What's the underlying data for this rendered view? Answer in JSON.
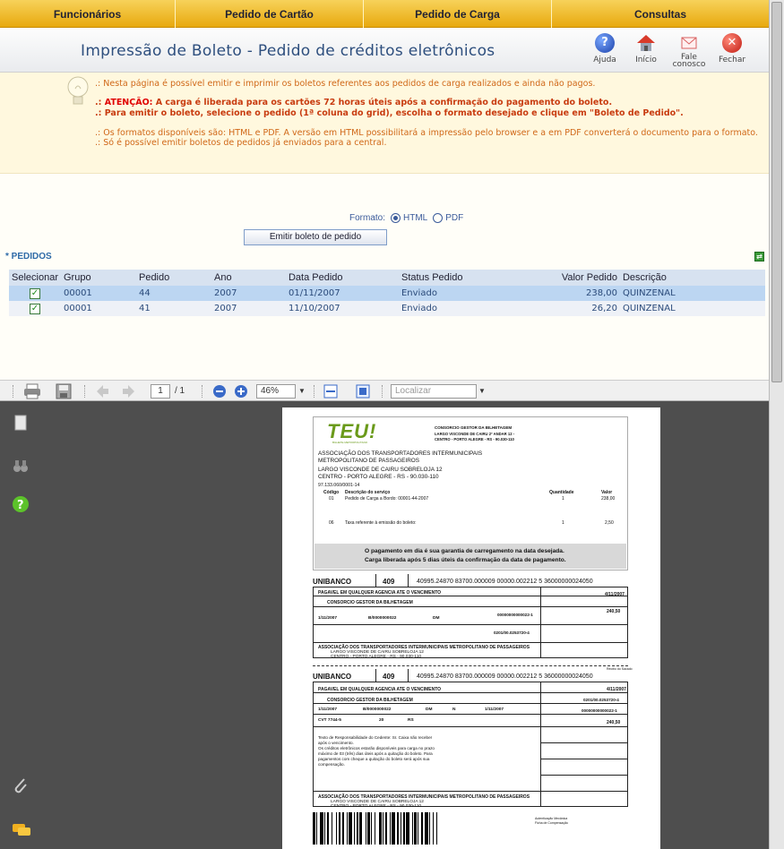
{
  "menu": [
    "Funcionários",
    "Pedido de Cartão",
    "Pedido de Carga",
    "Consultas"
  ],
  "header": {
    "title": "Impressão de Boleto - Pedido de créditos eletrônicos",
    "buttons": {
      "help": "Ajuda",
      "home": "Início",
      "contact_line1": "Fale",
      "contact_line2": "conosco",
      "close": "Fechar"
    }
  },
  "info": {
    "line1": ".: Nesta página é possível emitir e imprimir os boletos referentes aos pedidos de carga realizados e ainda não pagos.",
    "attention_prefix": ".: ",
    "attention_word": "ATENÇÃO:",
    "attention_text": " A carga é liberada para os cartões 72 horas úteis após a confirmação do pagamento do boleto.",
    "line3": ".: Para emitir o boleto, selecione o pedido (1ª coluna do grid), escolha o formato desejado e clique em \"Boleto de Pedido\".",
    "line4": ".: Os formatos disponíveis são: HTML e PDF. A versão em HTML possibilitará a impressão pelo browser e a em PDF converterá o documento para o formato.",
    "line5": ".: Só é possível emitir boletos de pedidos já enviados para a central."
  },
  "form": {
    "format_label": "Formato:",
    "option_html": "HTML",
    "option_pdf": "PDF",
    "selected": "HTML",
    "emit_button": "Emitir boleto de pedido",
    "section_label": "* PEDIDOS"
  },
  "grid": {
    "headers": [
      "Selecionar",
      "Grupo",
      "Pedido",
      "Ano",
      "Data Pedido",
      "Status Pedido",
      "Valor Pedido",
      "Descrição"
    ],
    "rows": [
      {
        "grupo": "00001",
        "pedido": "44",
        "ano": "2007",
        "data": "01/11/2007",
        "status": "Enviado",
        "valor": "238,00",
        "descricao": "QUINZENAL",
        "selected": true
      },
      {
        "grupo": "00001",
        "pedido": "41",
        "ano": "2007",
        "data": "11/10/2007",
        "status": "Enviado",
        "valor": "26,20",
        "descricao": "QUINZENAL",
        "selected": false
      }
    ]
  },
  "pdf_toolbar": {
    "page_current": "1",
    "page_total": "/ 1",
    "zoom": "46%",
    "search_placeholder": "Localizar"
  },
  "doc": {
    "logo": "TEU!",
    "logo_sub": "BILHETE METROPOLITANO",
    "company_name": "CONSORCIO GESTOR DA BILHETAGEM",
    "company_addr1": "LARGO VISCONDE DE CAIRU 2º ANDAR 12 -",
    "company_addr2": "CENTRO - PORTO ALEGRE - RS - 90.030-110",
    "client1": "ASSOCIAÇÃO DOS TRANSPORTADORES INTERMUNICIPAIS",
    "client2": "METROPOLITANO DE PASSAGEIROS",
    "client3": "LARGO VISCONDE DE CAIRU SOBRELOJA 12",
    "client4": "CENTRO - PORTO ALEGRE - RS - 90.030-110",
    "client5": "97.133.060/0001-14",
    "items_headers": [
      "Código",
      "Descrição do serviço",
      "Quantidade",
      "Valor"
    ],
    "items": [
      {
        "code": "01",
        "desc": "Pedido de Carga a Bordo: 00001-44-2007",
        "qty": "1",
        "value": "238,00"
      },
      {
        "code": "06",
        "desc": "Taxa referente à emissão do boleto:",
        "qty": "1",
        "value": "2,50"
      }
    ],
    "notice1": "O pagamento em dia é sua garantia de carregamento na data desejada.",
    "notice2": "Carga liberada após 5 dias úteis da confirmação da data de pagamento.",
    "bank": "UNIBANCO",
    "bank_code": "409",
    "digitable": "40995.24870 83700.000009 00000.002212 5 36000000024050",
    "due": "4/11/2007",
    "pay_place": "PAGAVEL EM QUALQUER AGENCIA ATE O VENCIMENTO",
    "cedente": "CONSORCIO GESTOR DA BILHETAGEM",
    "doc_value": "240,50",
    "doc_date": "1/11/2007",
    "doc_number": "B/0000000022",
    "species": "DM",
    "aceite": "N",
    "proc_date": "1/11/2007",
    "nosso_numero": "00000000000022-1",
    "agencia": "0201/00.0253720-4",
    "carteira": "CVT 7744-5",
    "especie_moeda": "RS",
    "currency_code": "20",
    "sacado1": "ASSOCIAÇÃO DOS TRANSPORTADORES INTERMUNICIPAIS METROPOLITANO DE PASSAGEIROS",
    "sacado2": "LARGO VISCONDE DE CAIRU SOBRELOJA 12",
    "sacado3": "CENTRO - PORTO ALEGRE - RS - 90.030-110",
    "instr1": "Texto de Responsabilidade do Cedente: Sr. Caixa não receber",
    "instr2": "após o vencimento.",
    "instr3": "Os créditos eletrônicos estarão disponíveis para carga no prazo",
    "instr4": "máximo de 03 (três) dias úteis após a quitação do boleto. Para",
    "instr5": "pagamentos com cheque a quitação do boleto será após sua",
    "instr6": "compensação.",
    "recibo": "Recibo do Sacado",
    "autent1": "Autenticação Mecânica",
    "autent2": "Ficha de Compensação"
  },
  "colors": {
    "menu_bg": "#e8a90e",
    "title": "#2e4f7e",
    "info_bg": "#fff8de",
    "selected_row": "#bcd6f2",
    "pdf_bg": "#4e4e4e"
  }
}
